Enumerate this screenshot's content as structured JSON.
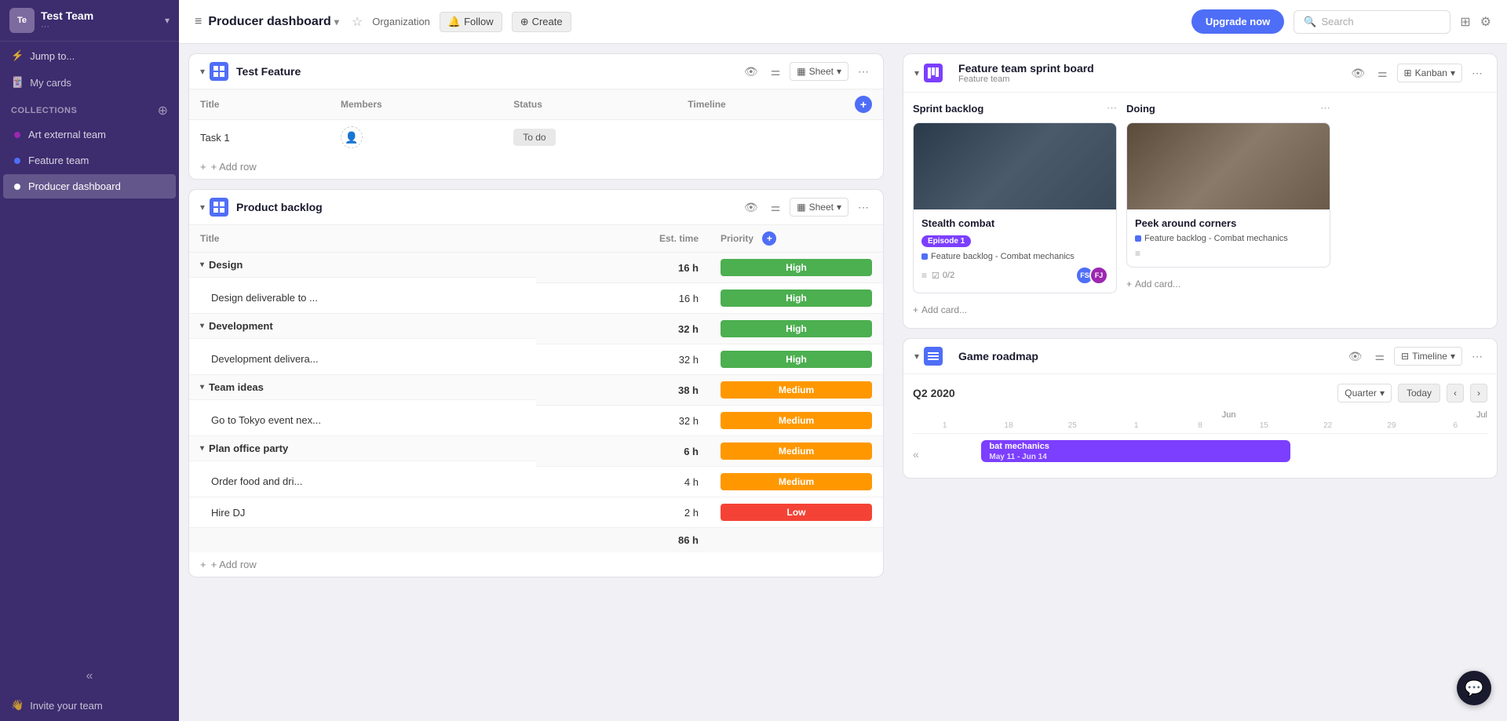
{
  "sidebar": {
    "team_avatar": "Te",
    "team_name": "Test Team",
    "team_sub": "···",
    "jump_to": "Jump to...",
    "my_cards": "My cards",
    "collections_label": "Collections",
    "items": [
      {
        "id": "art-external-team",
        "label": "Art external team",
        "color": "#9c27b0"
      },
      {
        "id": "feature-team",
        "label": "Feature team",
        "color": "#4f6ef7"
      },
      {
        "id": "producer-dashboard",
        "label": "Producer dashboard",
        "color": "#4f6ef7",
        "active": true
      }
    ],
    "invite_team": "Invite your team",
    "collapse_label": "«"
  },
  "topbar": {
    "title": "Producer dashboard",
    "chevron": "▾",
    "org": "Organization",
    "follow": "Follow",
    "create": "Create",
    "upgrade": "Upgrade now",
    "search_placeholder": "Search"
  },
  "test_feature": {
    "title": "Test Feature",
    "view": "Sheet",
    "columns": [
      "Title",
      "Members",
      "Status",
      "Timeline"
    ],
    "rows": [
      {
        "title": "Task 1",
        "member": "",
        "status": "To do",
        "timeline": ""
      }
    ],
    "add_row": "+ Add row"
  },
  "product_backlog": {
    "title": "Product backlog",
    "view": "Sheet",
    "columns": [
      "Title",
      "Est. time",
      "Priority"
    ],
    "groups": [
      {
        "name": "Design",
        "est": "16 h",
        "priority": "High",
        "priority_class": "priority-high",
        "rows": [
          {
            "title": "Design deliverable to ...",
            "est": "16 h",
            "priority": "High",
            "priority_class": "priority-high"
          }
        ]
      },
      {
        "name": "Development",
        "est": "32 h",
        "priority": "High",
        "priority_class": "priority-high",
        "rows": [
          {
            "title": "Development delivera...",
            "est": "32 h",
            "priority": "High",
            "priority_class": "priority-high"
          }
        ]
      },
      {
        "name": "Team ideas",
        "est": "38 h",
        "priority": "Medium",
        "priority_class": "priority-medium",
        "rows": [
          {
            "title": "Go to Tokyo event nex...",
            "est": "32 h",
            "priority": "Medium",
            "priority_class": "priority-medium"
          }
        ]
      },
      {
        "name": "Plan office party",
        "est": "6 h",
        "priority": "Medium",
        "priority_class": "priority-medium",
        "rows": [
          {
            "title": "Order food and dri...",
            "est": "4 h",
            "priority": "Medium",
            "priority_class": "priority-medium"
          },
          {
            "title": "Hire DJ",
            "est": "2 h",
            "priority": "Low",
            "priority_class": "priority-low"
          }
        ]
      }
    ],
    "total_est": "86 h",
    "add_row": "+ Add row"
  },
  "feature_sprint": {
    "title": "Feature team sprint board",
    "subtitle": "Feature team",
    "view": "Kanban",
    "columns": [
      {
        "name": "Sprint backlog",
        "cards": [
          {
            "title": "Stealth combat",
            "episode_tag": "Episode 1",
            "feature_tag": "Feature backlog - Combat mechanics",
            "has_description": true,
            "checklist": "0/2",
            "members": [
              "FS",
              "FJ"
            ]
          }
        ],
        "add_card": "Add card..."
      },
      {
        "name": "Doing",
        "cards": [
          {
            "title": "Peek around corners",
            "feature_tag": "Feature backlog - Combat mechanics",
            "has_description": true
          }
        ],
        "add_card": "Add card..."
      }
    ]
  },
  "game_roadmap": {
    "title": "Game roadmap",
    "view": "Timeline",
    "quarter": "Q2 2020",
    "quarter_selector": "Quarter",
    "today_btn": "Today",
    "dates": {
      "may_dates": [
        "1",
        "18",
        "25"
      ],
      "jun_label": "Jun",
      "jun_dates": [
        "1",
        "8",
        "15",
        "22",
        "29"
      ],
      "jul_label": "Jul",
      "jul_dates": [
        "6"
      ]
    },
    "bar": {
      "label": "bat mechanics",
      "sub_label": "May 11 - Jun 14",
      "color": "#7c3fff"
    }
  }
}
